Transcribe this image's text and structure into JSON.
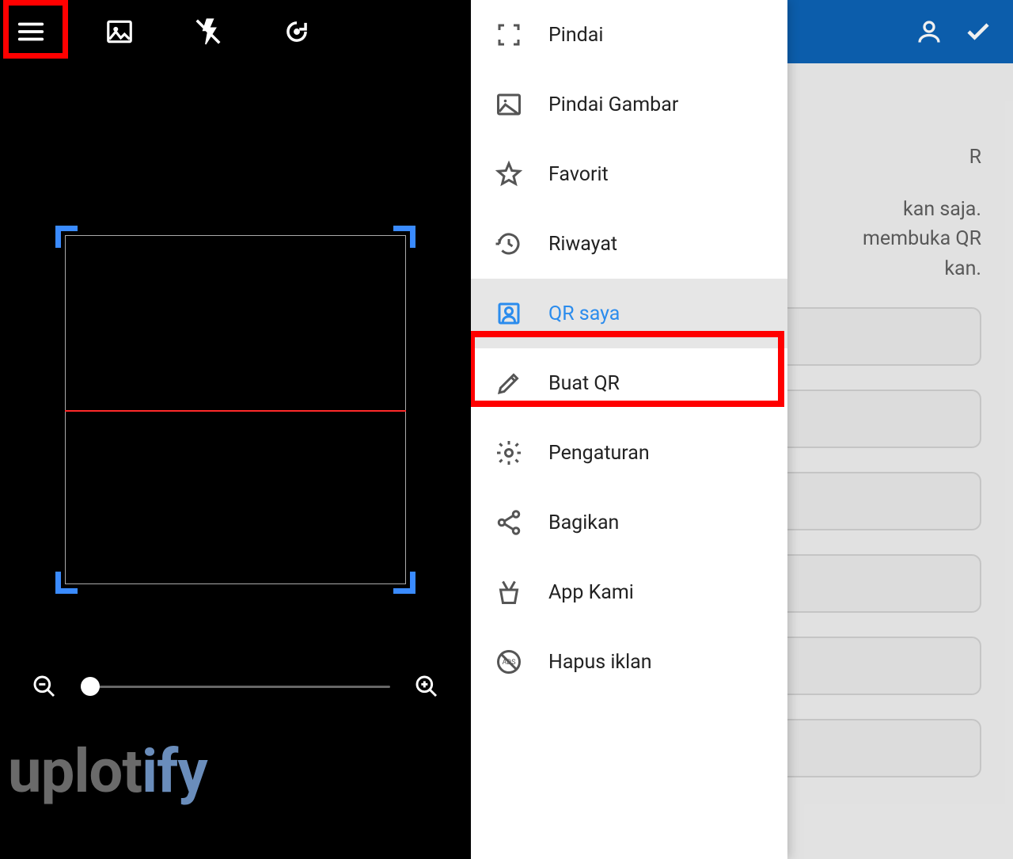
{
  "colors": {
    "accent": "#3a8bff",
    "highlight": "#ff0000",
    "header": "#0d63b6",
    "scan_line": "#ff2a2a"
  },
  "watermark": {
    "pre": "uplot",
    "accent": "ify"
  },
  "menu": {
    "items": [
      {
        "label": "Pindai",
        "icon": "scan-icon"
      },
      {
        "label": "Pindai Gambar",
        "icon": "image-icon"
      },
      {
        "label": "Favorit",
        "icon": "star-icon"
      },
      {
        "label": "Riwayat",
        "icon": "history-icon"
      },
      {
        "label": "QR saya",
        "icon": "profile-card-icon",
        "selected": true
      },
      {
        "label": "Buat QR",
        "icon": "pencil-icon",
        "highlighted": true
      },
      {
        "label": "Pengaturan",
        "icon": "gear-icon"
      },
      {
        "label": "Bagikan",
        "icon": "share-icon"
      },
      {
        "label": "App Kami",
        "icon": "app-icon"
      },
      {
        "label": "Hapus iklan",
        "icon": "no-ads-icon"
      }
    ]
  },
  "background_page": {
    "partial_title": "R",
    "line1": "kan saja.",
    "line2": "membuka QR",
    "line3": "kan."
  }
}
